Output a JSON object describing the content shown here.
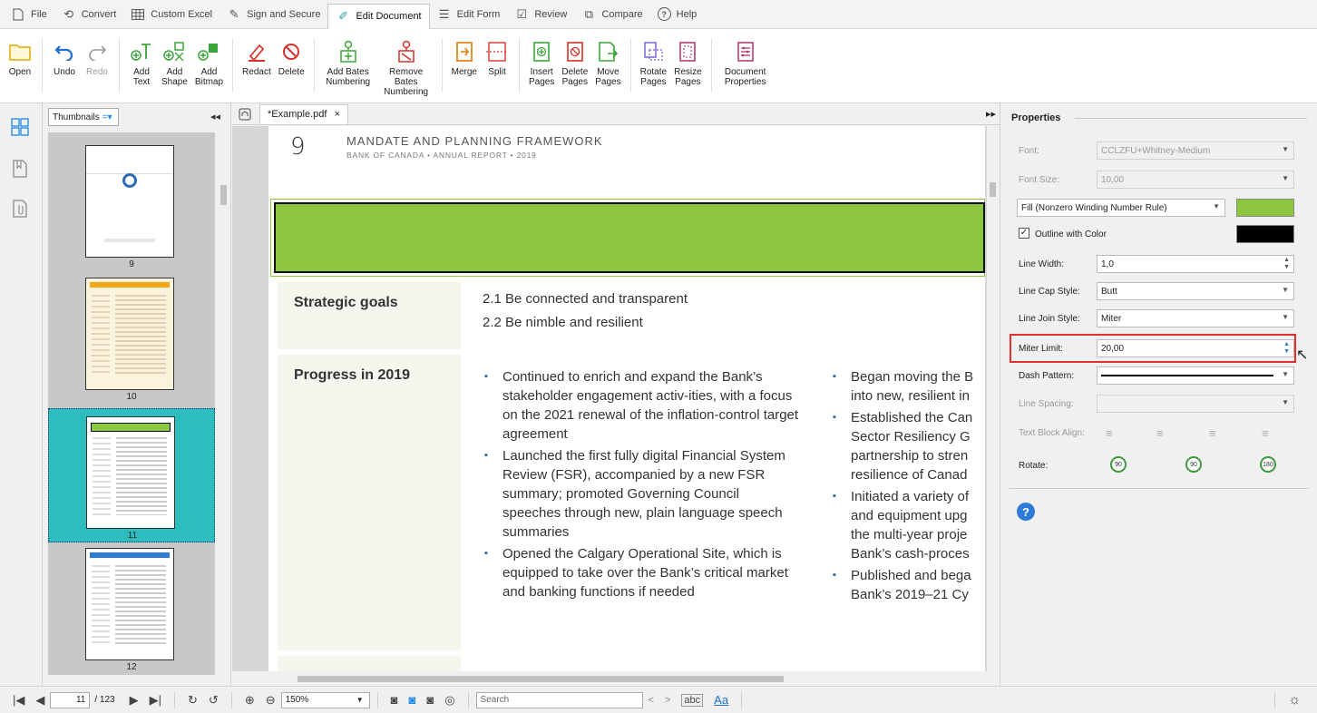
{
  "menu": {
    "items": [
      {
        "label": "File",
        "icon": "file-icon"
      },
      {
        "label": "Convert",
        "icon": "convert-icon"
      },
      {
        "label": "Custom Excel",
        "icon": "grid-icon"
      },
      {
        "label": "Sign and Secure",
        "icon": "pen-icon"
      },
      {
        "label": "Edit Document",
        "icon": "edit-document-icon",
        "active": true
      },
      {
        "label": "Edit Form",
        "icon": "form-icon"
      },
      {
        "label": "Review",
        "icon": "review-icon"
      },
      {
        "label": "Compare",
        "icon": "compare-icon"
      },
      {
        "label": "Help",
        "icon": "help-icon"
      }
    ]
  },
  "ribbon": {
    "open": "Open",
    "undo": "Undo",
    "redo": "Redo",
    "add_text": "Add\nText",
    "add_shape": "Add\nShape",
    "add_bitmap": "Add\nBitmap",
    "redact": "Redact",
    "delete": "Delete",
    "add_bates": "Add Bates\nNumbering",
    "remove_bates": "Remove Bates\nNumbering",
    "merge": "Merge",
    "split": "Split",
    "insert_pages": "Insert\nPages",
    "delete_pages": "Delete\nPages",
    "move_pages": "Move\nPages",
    "rotate_pages": "Rotate\nPages",
    "resize_pages": "Resize\nPages",
    "document_properties": "Document\nProperties"
  },
  "thumbnails": {
    "selector": "Thumbnails",
    "pages": [
      {
        "num": "9"
      },
      {
        "num": "10"
      },
      {
        "num": "11",
        "selected": true
      },
      {
        "num": "12"
      }
    ]
  },
  "doc": {
    "tab_name": "*Example.pdf",
    "tab_close": "×",
    "page_number": "9",
    "title": "MANDATE AND PLANNING FRAMEWORK",
    "subtitle": "BANK OF CANADA  •  ANNUAL REPORT  •  2019",
    "strategic_label": "Strategic goals",
    "goal_1": "2.1 Be connected and transparent",
    "goal_2": "2.2 Be nimble and resilient",
    "progress_label": "Progress in 2019",
    "progress_left": [
      "Continued to enrich and expand the Bank’s stakeholder engagement activ-ities, with a focus on the 2021 renewal of the inflation-control target agreement",
      "Launched the first fully digital Financial System Review (FSR), accompanied by a new FSR summary; promoted Governing Council speeches through new, plain language speech summaries",
      "Opened the Calgary Operational Site, which is equipped to take over the Bank’s critical market and banking functions if needed"
    ],
    "progress_right": [
      "Began moving the B into new, resilient in",
      "Established the Can Sector Resiliency G partnership to stren resilience of Canad",
      "Initiated a variety of and equipment upg the multi-year proje Bank’s cash-proces",
      "Published and bega Bank’s 2019–21 Cy"
    ],
    "fill_color": "#8dc63f"
  },
  "properties": {
    "title": "Properties",
    "font_label": "Font:",
    "font_value": "CCLZFU+Whitney-Medium",
    "font_size_label": "Font Size:",
    "font_size_value": "10,00",
    "fill_mode": "Fill (Nonzero Winding Number Rule)",
    "fill_color": "#8dc63f",
    "outline_label": "Outline with Color",
    "outline_checked": true,
    "outline_color": "#000000",
    "line_width_label": "Line Width:",
    "line_width_value": "1,0",
    "line_cap_label": "Line Cap Style:",
    "line_cap_value": "Butt",
    "line_join_label": "Line Join Style:",
    "line_join_value": "Miter",
    "miter_label": "Miter Limit:",
    "miter_value": "20,00",
    "dash_label": "Dash Pattern:",
    "line_spacing_label": "Line Spacing:",
    "text_align_label": "Text Block Align:",
    "rotate_label": "Rotate:",
    "rotate_options": [
      "90",
      "90",
      "180"
    ]
  },
  "status": {
    "current_page": "11",
    "total_pages": "/ 123",
    "zoom": "150%",
    "search_placeholder": "Search"
  }
}
